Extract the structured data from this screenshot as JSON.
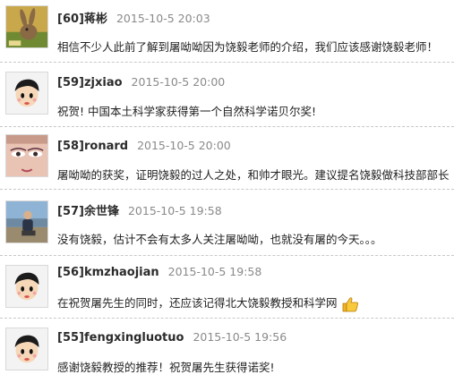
{
  "comments": [
    {
      "author": "[60]蒋彬",
      "time": "2015-10-5 20:03",
      "text": "相信不少人此前了解到屠呦呦因为饶毅老师的介绍，我们应该感谢饶毅老师！"
    },
    {
      "author": "[59]zjxiao",
      "time": "2015-10-5 20:00",
      "text": "祝贺! 中国本土科学家获得第一个自然科学诺贝尔奖!"
    },
    {
      "author": "[58]ronard",
      "time": "2015-10-5 20:00",
      "text": "屠呦呦的获奖，证明饶毅的过人之处，和帅才眼光。建议提名饶毅做科技部部长"
    },
    {
      "author": "[57]余世锋",
      "time": "2015-10-5 19:58",
      "text": "没有饶毅，估计不会有太多人关注屠呦呦，也就没有屠的今天。。。"
    },
    {
      "author": "[56]kmzhaojian",
      "time": "2015-10-5 19:58",
      "text": "在祝贺屠先生的同时，还应该记得北大饶毅教授和科学网"
    },
    {
      "author": "[55]fengxingluotuo",
      "time": "2015-10-5 19:56",
      "text": "感谢饶毅教授的推荐！祝贺屠先生获得诺奖!"
    }
  ]
}
